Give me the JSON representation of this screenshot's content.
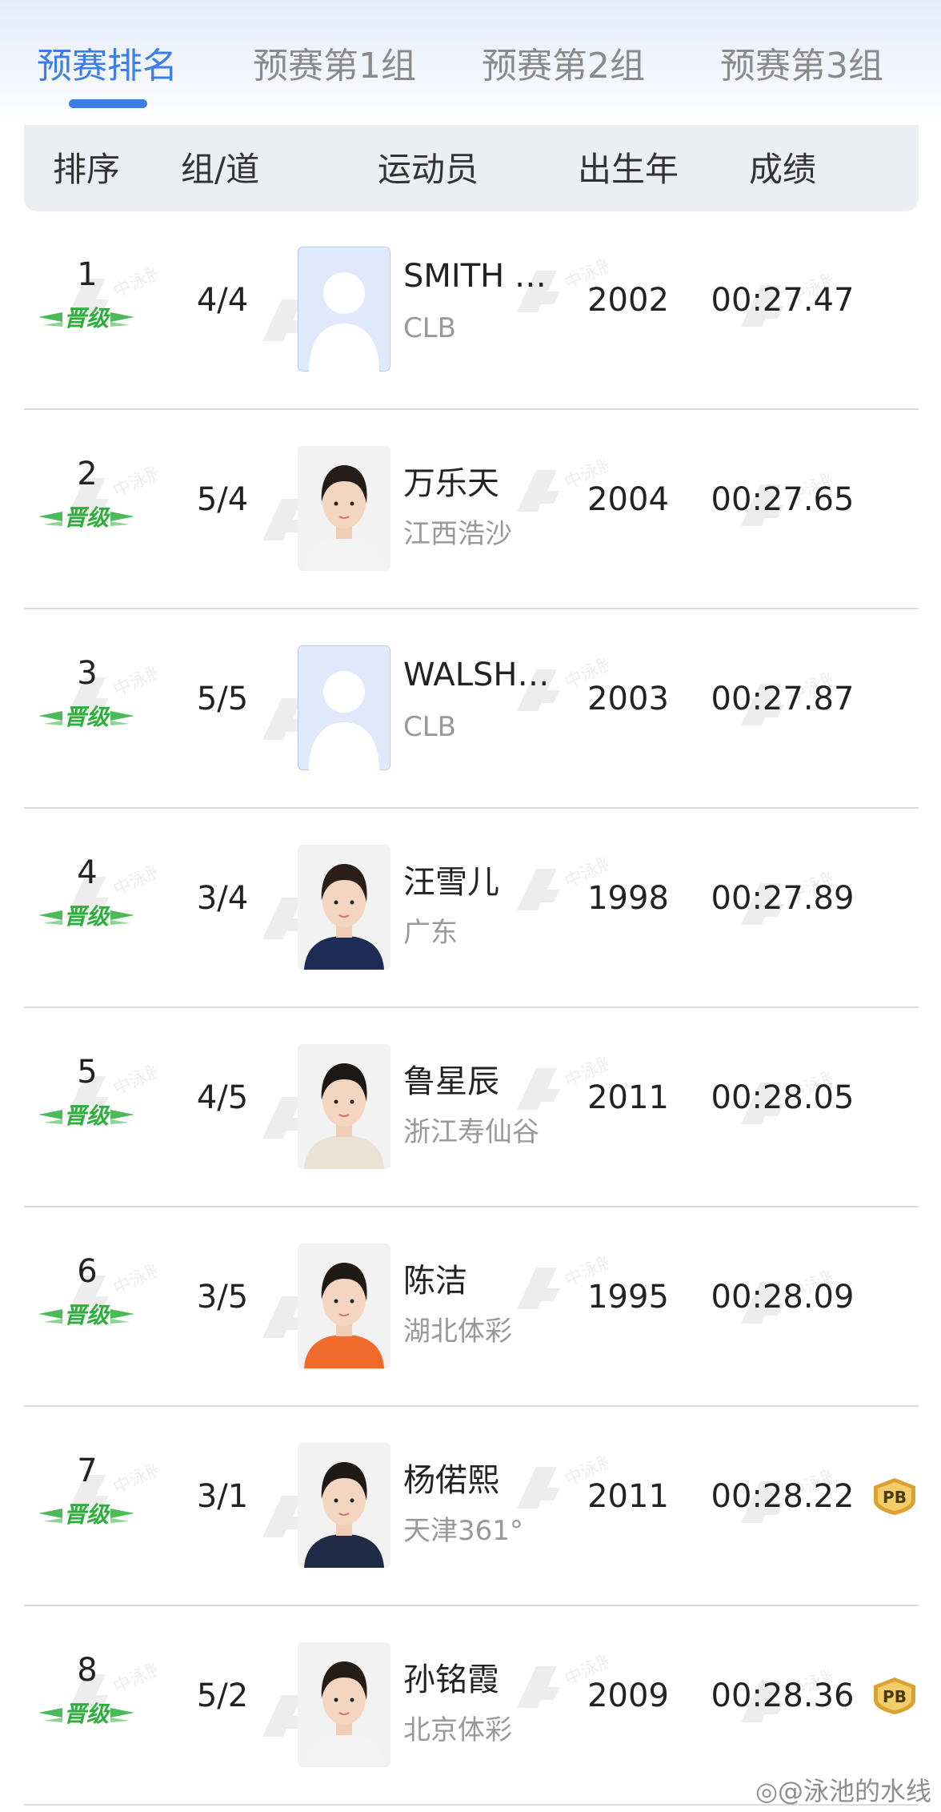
{
  "tabs": [
    {
      "label": "预赛排名",
      "active": true
    },
    {
      "label": "预赛第1组",
      "active": false
    },
    {
      "label": "预赛第2组",
      "active": false
    },
    {
      "label": "预赛第3组",
      "active": false
    }
  ],
  "table": {
    "headers": {
      "rank": "排序",
      "lane": "组/道",
      "athlete": "运动员",
      "birth_year": "出生年",
      "result": "成绩"
    },
    "qualified_label": "晋级",
    "pb_label": "PB",
    "rows": [
      {
        "rank": "1",
        "lane": "4/4",
        "name": "SMITH …",
        "team": "CLB",
        "year": "2002",
        "time": "00:27.47",
        "photo": "placeholder",
        "pb": false
      },
      {
        "rank": "2",
        "lane": "5/4",
        "name": "万乐天",
        "team": "江西浩沙",
        "year": "2004",
        "time": "00:27.65",
        "photo": "athlete",
        "pb": false
      },
      {
        "rank": "3",
        "lane": "5/5",
        "name": "WALSH…",
        "team": "CLB",
        "year": "2003",
        "time": "00:27.87",
        "photo": "placeholder",
        "pb": false
      },
      {
        "rank": "4",
        "lane": "3/4",
        "name": "汪雪儿",
        "team": "广东",
        "year": "1998",
        "time": "00:27.89",
        "photo": "athlete",
        "pb": false
      },
      {
        "rank": "5",
        "lane": "4/5",
        "name": "鲁星辰",
        "team": "浙江寿仙谷",
        "year": "2011",
        "time": "00:28.05",
        "photo": "athlete",
        "pb": false
      },
      {
        "rank": "6",
        "lane": "3/5",
        "name": "陈洁",
        "team": "湖北体彩",
        "year": "1995",
        "time": "00:28.09",
        "photo": "athlete",
        "pb": false
      },
      {
        "rank": "7",
        "lane": "3/1",
        "name": "杨偌熙",
        "team": "天津361°",
        "year": "2011",
        "time": "00:28.22",
        "photo": "athlete",
        "pb": true
      },
      {
        "rank": "8",
        "lane": "5/2",
        "name": "孙铭霞",
        "team": "北京体彩",
        "year": "2009",
        "time": "00:28.36",
        "photo": "athlete",
        "pb": true
      }
    ]
  },
  "watermark": {
    "text": "中泳股份"
  },
  "footer": {
    "weibo_text": "@泳池的水线"
  },
  "colors": {
    "accent": "#3d7de8",
    "qualified": "#2eae3c",
    "pb": "#d9a233"
  }
}
